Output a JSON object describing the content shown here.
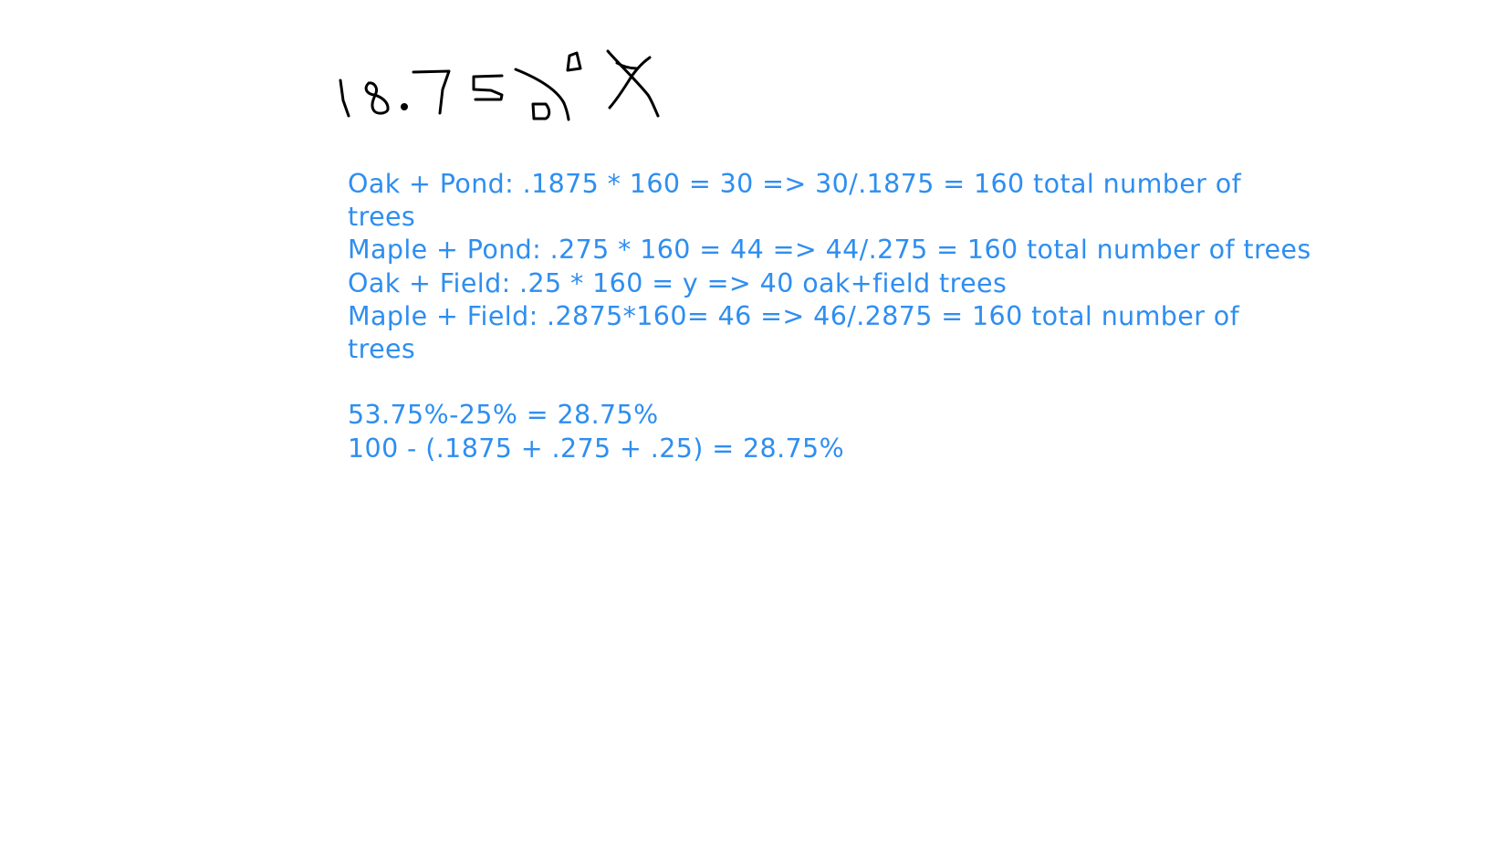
{
  "handwriting": {
    "text": "18.75a^0 X",
    "color": "#000000"
  },
  "notes": {
    "color": "#2e8ef0",
    "lines": [
      "Oak + Pond: .1875 * 160 = 30 => 30/.1875 = 160 total number of",
      "trees",
      "Maple + Pond: .275 * 160 = 44 => 44/.275 = 160 total number of trees",
      "Oak + Field: .25 * 160 = y => 40 oak+field trees",
      "Maple + Field: .2875*160= 46 => 46/.2875 = 160 total number of",
      "trees",
      "",
      "53.75%-25% = 28.75%",
      "100 - (.1875 + .275 + .25) = 28.75%"
    ]
  }
}
